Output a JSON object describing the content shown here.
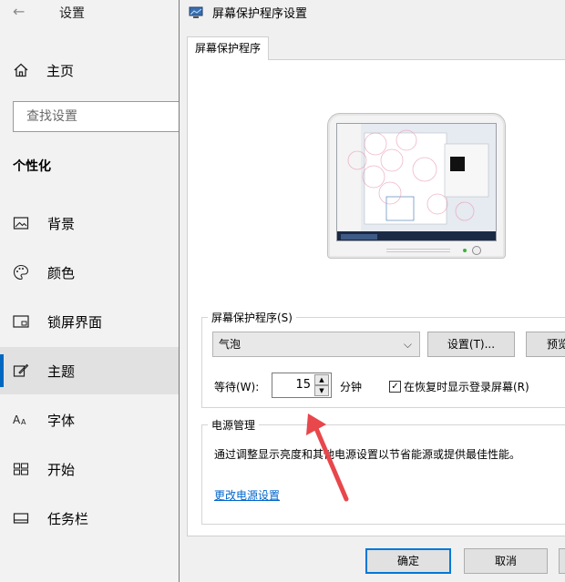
{
  "settings_app": {
    "title": "设置",
    "home_label": "主页",
    "search_placeholder": "查找设置",
    "section_title": "个性化",
    "nav_items": [
      {
        "label": "背景",
        "icon": "image-icon"
      },
      {
        "label": "颜色",
        "icon": "palette-icon"
      },
      {
        "label": "锁屏界面",
        "icon": "lock-screen-icon"
      },
      {
        "label": "主题",
        "icon": "theme-icon",
        "selected": true
      },
      {
        "label": "字体",
        "icon": "font-icon"
      },
      {
        "label": "开始",
        "icon": "start-icon"
      },
      {
        "label": "任务栏",
        "icon": "taskbar-icon"
      }
    ]
  },
  "dialog": {
    "title": "屏幕保护程序设置",
    "tab_label": "屏幕保护程序",
    "screensaver_group_title": "屏幕保护程序(S)",
    "screensaver_selected": "气泡",
    "settings_button": "设置(T)...",
    "preview_button": "预览",
    "wait_label": "等待(W):",
    "wait_value": "15",
    "minutes_label": "分钟",
    "resume_checkbox_label": "在恢复时显示登录屏幕(R)",
    "resume_checked": true,
    "power_group_title": "电源管理",
    "power_description": "通过调整显示亮度和其他电源设置以节省能源或提供最佳性能。",
    "power_link": "更改电源设置",
    "ok_button": "确定",
    "cancel_button": "取消"
  },
  "colors": {
    "accent": "#0067c0",
    "link": "#0066cc",
    "annotation_arrow": "#e8474b"
  }
}
